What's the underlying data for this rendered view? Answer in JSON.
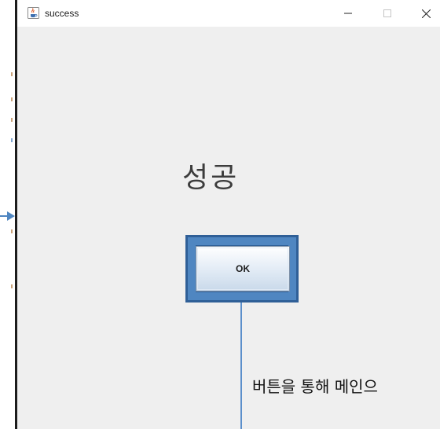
{
  "window": {
    "title": "success",
    "icon": "java-cup-icon",
    "controls": [
      "minimize",
      "maximize",
      "close"
    ]
  },
  "content": {
    "headline": "성공",
    "ok_button_label": "OK"
  },
  "annotation": {
    "text": "버튼을 통해 메인으",
    "accent_color": "#4f86c1"
  }
}
